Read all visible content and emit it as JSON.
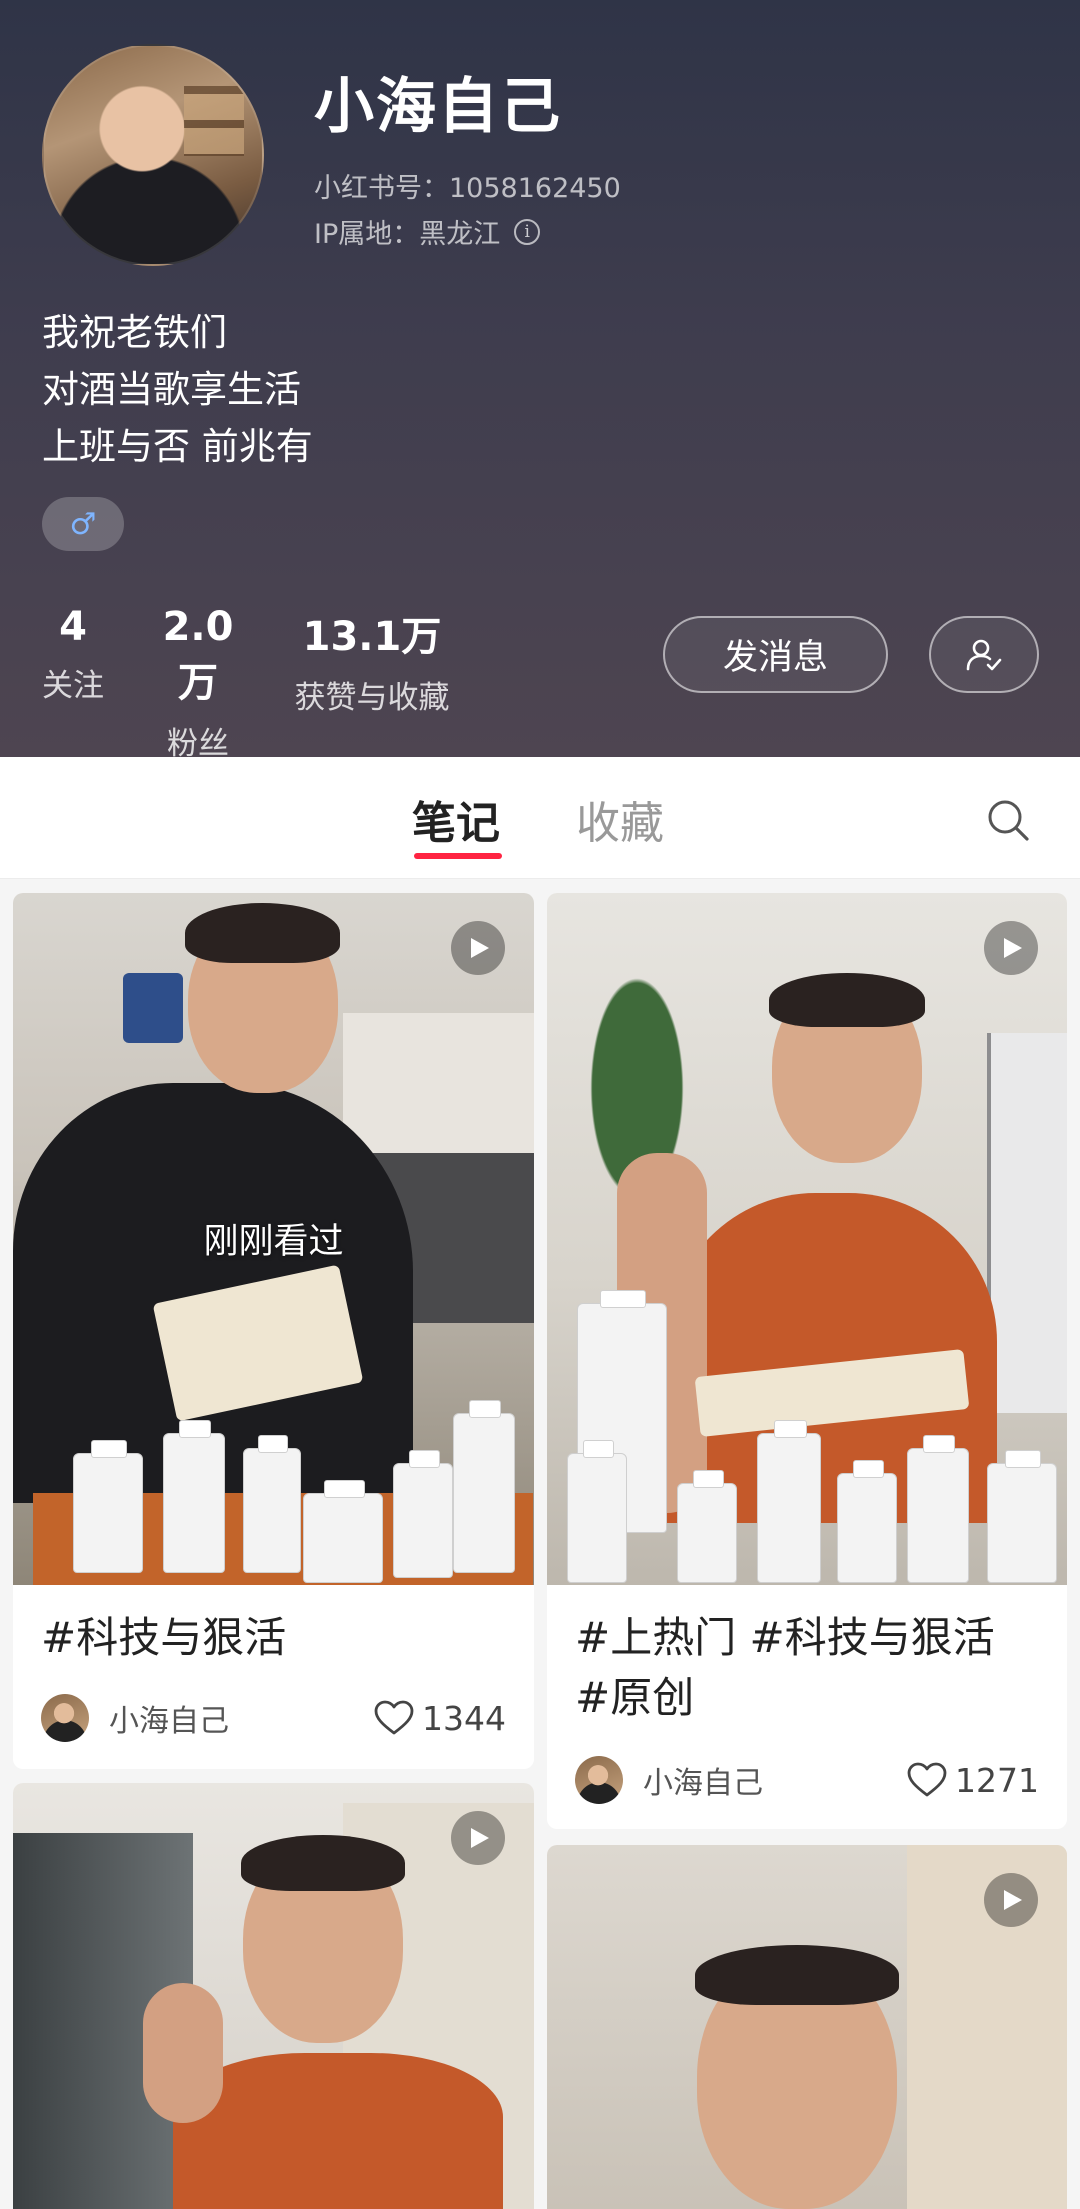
{
  "profile": {
    "username": "小海自己",
    "red_id": "小红书号：1058162450",
    "ip_location": "IP属地：黑龙江",
    "bio": [
      "我祝老铁们",
      "对酒当歌享生活",
      "上班与否 前兆有"
    ],
    "gender_symbol": "♂",
    "stats": [
      {
        "value": "4",
        "label": "关注"
      },
      {
        "value": "2.0万",
        "label": "粉丝"
      },
      {
        "value": "13.1万",
        "label": "获赞与收藏"
      }
    ],
    "message_button": "发消息"
  },
  "tabs": {
    "notes": "笔记",
    "collections": "收藏"
  },
  "feed": {
    "notes": [
      {
        "title": "#科技与狠活",
        "author": "小海自己",
        "likes": "1344",
        "overlay": "刚刚看过",
        "is_video": true
      },
      {
        "title": "#上热门 #科技与狠活 #原创",
        "author": "小海自己",
        "likes": "1271",
        "is_video": true
      },
      {
        "is_video": true
      },
      {
        "is_video": true
      }
    ]
  },
  "colors": {
    "accent": "#ff2442",
    "header_top": "#2f3447",
    "header_bottom": "#4e4551"
  },
  "icons": [
    "info-icon",
    "male-icon",
    "follow-check-icon",
    "search-icon",
    "play-icon",
    "heart-icon"
  ]
}
